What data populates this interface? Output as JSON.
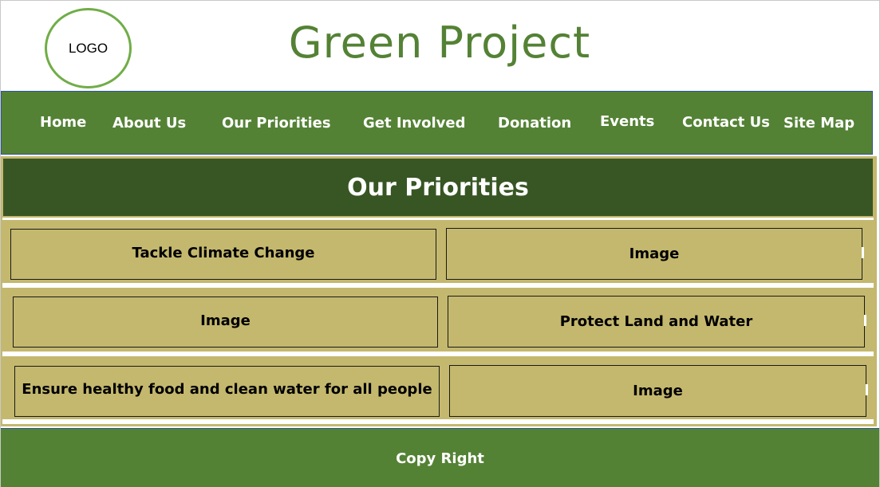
{
  "header": {
    "logo_text": "LOGO",
    "title": "Green Project"
  },
  "nav": {
    "items": [
      {
        "label": "Home"
      },
      {
        "label": "About Us"
      },
      {
        "label": "Our Priorities"
      },
      {
        "label": "Get Involved"
      },
      {
        "label": "Donation"
      },
      {
        "label": "Events"
      },
      {
        "label": "Contact Us"
      },
      {
        "label": "Site Map"
      }
    ]
  },
  "section": {
    "title": "Our Priorities"
  },
  "priorities": [
    {
      "left": "Tackle Climate Change",
      "right": "Image"
    },
    {
      "left": "Image",
      "right": "Protect Land and Water"
    },
    {
      "left": "Ensure healthy food and clean water for all people",
      "right": "Image"
    }
  ],
  "footer": {
    "text": "Copy Right"
  },
  "colors": {
    "brand_green": "#548235",
    "dark_green": "#375623",
    "khaki": "#c4b86e",
    "logo_ring": "#70ad47"
  }
}
